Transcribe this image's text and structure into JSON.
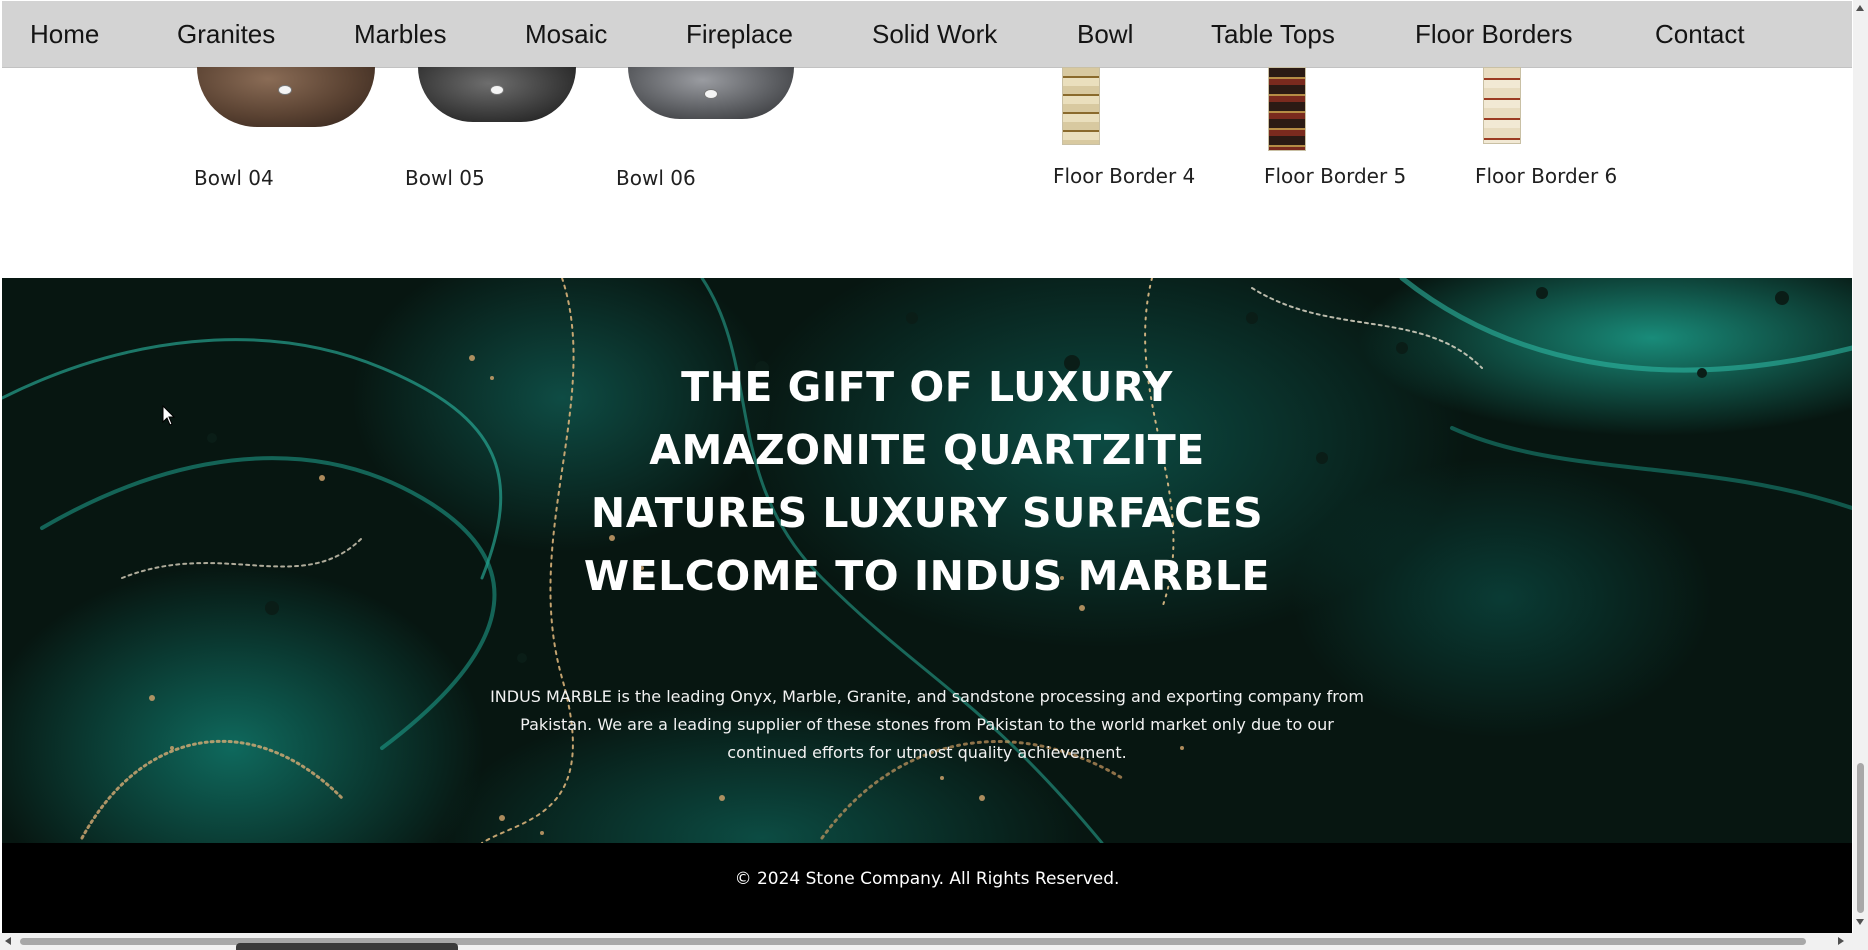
{
  "nav": {
    "items": [
      "Home",
      "Granites",
      "Marbles",
      "Mosaic",
      "Fireplace",
      "Solid Work",
      "Bowl",
      "Table Tops",
      "Floor Borders",
      "Contact"
    ]
  },
  "products": {
    "bowls": [
      {
        "label": "Bowl 04",
        "color": "#5a4232"
      },
      {
        "label": "Bowl 05",
        "color": "#3d3d3d"
      },
      {
        "label": "Bowl 06",
        "color": "#5d5f63"
      }
    ],
    "borders": [
      {
        "label": "Floor Border 4",
        "color": "#d8c9a0",
        "accent": "#8a6a2c"
      },
      {
        "label": "Floor Border 5",
        "color": "#2b1a14",
        "accent": "#b58c45"
      },
      {
        "label": "Floor Border 6",
        "color": "#e8dcc0",
        "accent": "#9b3b22"
      }
    ]
  },
  "hero": {
    "lines": [
      "THE GIFT OF LUXURY",
      "AMAZONITE QUARTZITE",
      "NATURES LUXURY SURFACES",
      "WELCOME TO INDUS MARBLE"
    ],
    "paragraph": "INDUS MARBLE is the leading Onyx, Marble, Granite, and sandstone processing and exporting company from Pakistan. We are a leading supplier of these stones from Pakistan to the world market only due to our continued efforts for utmost quality achievement."
  },
  "footer": {
    "copyright": "© 2024 Stone Company. All Rights Reserved."
  },
  "colors": {
    "nav_bg": "#d3d3d3",
    "hero_teal": "#1ca08c",
    "hero_dark": "#071611",
    "gold": "#c9a06a",
    "footer_bg": "#000000"
  }
}
